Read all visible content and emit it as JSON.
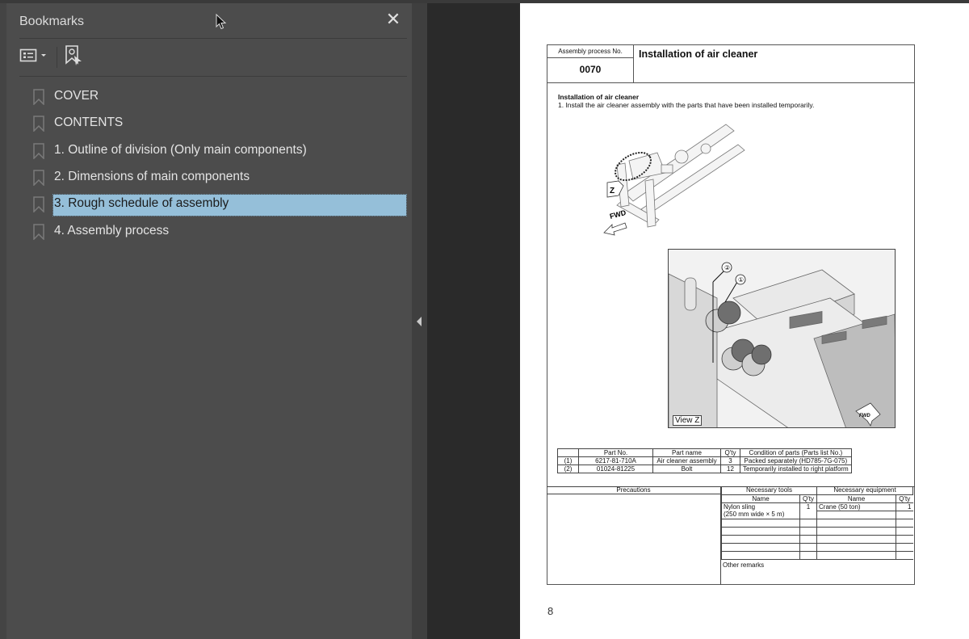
{
  "sidebar": {
    "title": "Bookmarks",
    "close_icon": "close-icon",
    "toolbar": {
      "options_icon": "list-options-icon",
      "find_bookmark_icon": "find-current-bookmark-icon"
    },
    "items": [
      {
        "label": "COVER",
        "selected": false
      },
      {
        "label": "CONTENTS",
        "selected": false
      },
      {
        "label": "1. Outline of division (Only main components)",
        "selected": false
      },
      {
        "label": "2. Dimensions of main components",
        "selected": false
      },
      {
        "label": "3. Rough schedule of assembly",
        "selected": true
      },
      {
        "label": "4. Assembly process",
        "selected": false
      }
    ],
    "selected_color": "#95bfd9"
  },
  "document": {
    "header": {
      "process_no_label": "Assembly process No.",
      "process_no": "0070",
      "title": "Installation of air cleaner"
    },
    "section": {
      "title": "Installation of air cleaner",
      "step": "1.   Install the air cleaner assembly with the parts that have been installed temporarily."
    },
    "figures": {
      "fig1_z_label": "Z",
      "fig1_fwd_label": "FWD",
      "fig2_callout_1": "①",
      "fig2_callout_2": "②",
      "fig2_view_label": "View Z",
      "fig2_fwd_label": "FWD"
    },
    "parts_table": {
      "headers": [
        "",
        "Part No.",
        "Part name",
        "Q'ty",
        "Condition of parts (Parts list No.)"
      ],
      "rows": [
        [
          "(1)",
          "6217-81-710A",
          "Air cleaner assembly",
          "3",
          "Packed separately (HD785-7G-075)"
        ],
        [
          "(2)",
          "01024-81225",
          "Bolt",
          "12",
          "Temporarily installed to right platform"
        ]
      ]
    },
    "bottom": {
      "precautions_label": "Precautions",
      "tools_label": "Necessary tools",
      "equipment_label": "Necessary equipment",
      "name_label": "Name",
      "qty_label": "Q'ty",
      "tool_1_name": "Nylon sling",
      "tool_1_spec": "(250 mm wide × 5 m)",
      "tool_1_qty": "1",
      "equip_1_name": "Crane (50 ton)",
      "equip_1_qty": "1",
      "remarks_label": "Other remarks"
    },
    "page_number": "8"
  }
}
